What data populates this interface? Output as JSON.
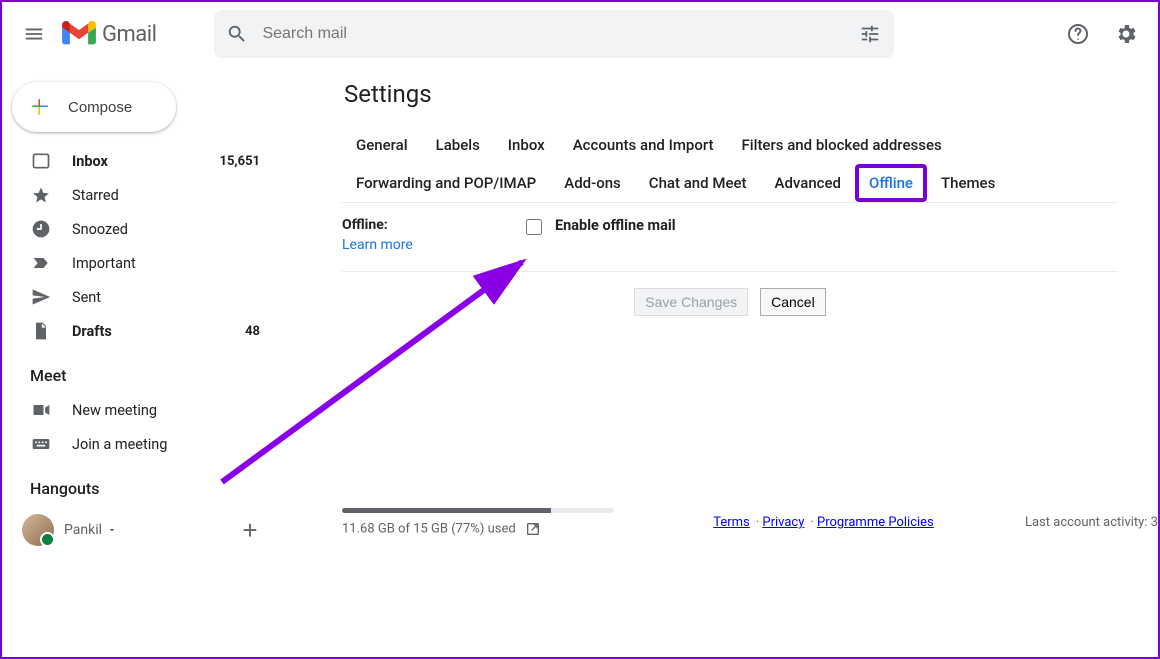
{
  "app": {
    "name": "Gmail"
  },
  "search": {
    "placeholder": "Search mail"
  },
  "compose_label": "Compose",
  "sidebar": {
    "items": [
      {
        "label": "Inbox",
        "count": "15,651",
        "bold": true
      },
      {
        "label": "Starred",
        "count": ""
      },
      {
        "label": "Snoozed",
        "count": ""
      },
      {
        "label": "Important",
        "count": ""
      },
      {
        "label": "Sent",
        "count": ""
      },
      {
        "label": "Drafts",
        "count": "48",
        "bold": true
      }
    ],
    "meet_header": "Meet",
    "meet_items": [
      {
        "label": "New meeting"
      },
      {
        "label": "Join a meeting"
      }
    ],
    "hangouts_header": "Hangouts",
    "hangouts_user": "Pankil"
  },
  "page": {
    "title": "Settings",
    "tabs": [
      "General",
      "Labels",
      "Inbox",
      "Accounts and Import",
      "Filters and blocked addresses",
      "Forwarding and POP/IMAP",
      "Add-ons",
      "Chat and Meet",
      "Advanced",
      "Offline",
      "Themes"
    ],
    "active_tab": "Offline",
    "offline": {
      "heading": "Offline:",
      "learn_more": "Learn more",
      "checkbox_label": "Enable offline mail"
    },
    "buttons": {
      "save": "Save Changes",
      "cancel": "Cancel"
    }
  },
  "footer": {
    "storage_text": "11.68 GB of 15 GB (77%) used",
    "storage_percent": 77,
    "links": [
      "Terms",
      "Privacy",
      "Programme Policies"
    ],
    "activity": "Last account activity: 3"
  }
}
